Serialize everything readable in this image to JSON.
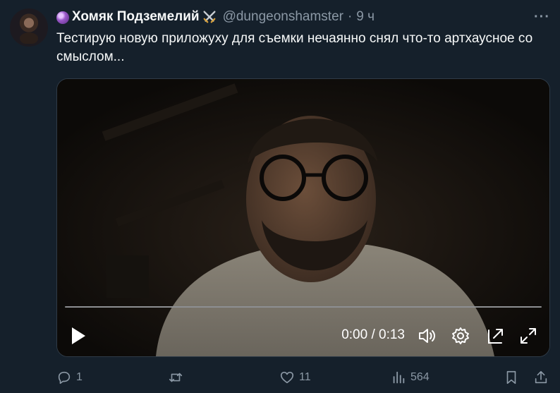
{
  "tweet": {
    "display_name": "Хомяк Подземелий",
    "handle": "@dungeonshamster",
    "separator": "·",
    "time": "9 ч",
    "more_label": "···",
    "text": "Тестирую новую приложуху для съемки нечаянно снял что-то артхаусное со смыслом..."
  },
  "video": {
    "time_label": "0:00 / 0:13",
    "progress": 0.0
  },
  "actions": {
    "reply_count": "1",
    "retweet_count": "",
    "like_count": "11",
    "views_count": "564"
  },
  "icons": {
    "play": "play-icon",
    "volume": "volume-icon",
    "settings": "gear-icon",
    "popout": "popout-icon",
    "fullscreen": "fullscreen-icon",
    "reply": "reply-icon",
    "retweet": "retweet-icon",
    "like": "heart-icon",
    "views": "views-icon",
    "bookmark": "bookmark-icon",
    "share": "share-icon"
  },
  "colors": {
    "background": "#15202b",
    "secondary_text": "#8b98a5",
    "primary_text": "#f7f9f9"
  }
}
